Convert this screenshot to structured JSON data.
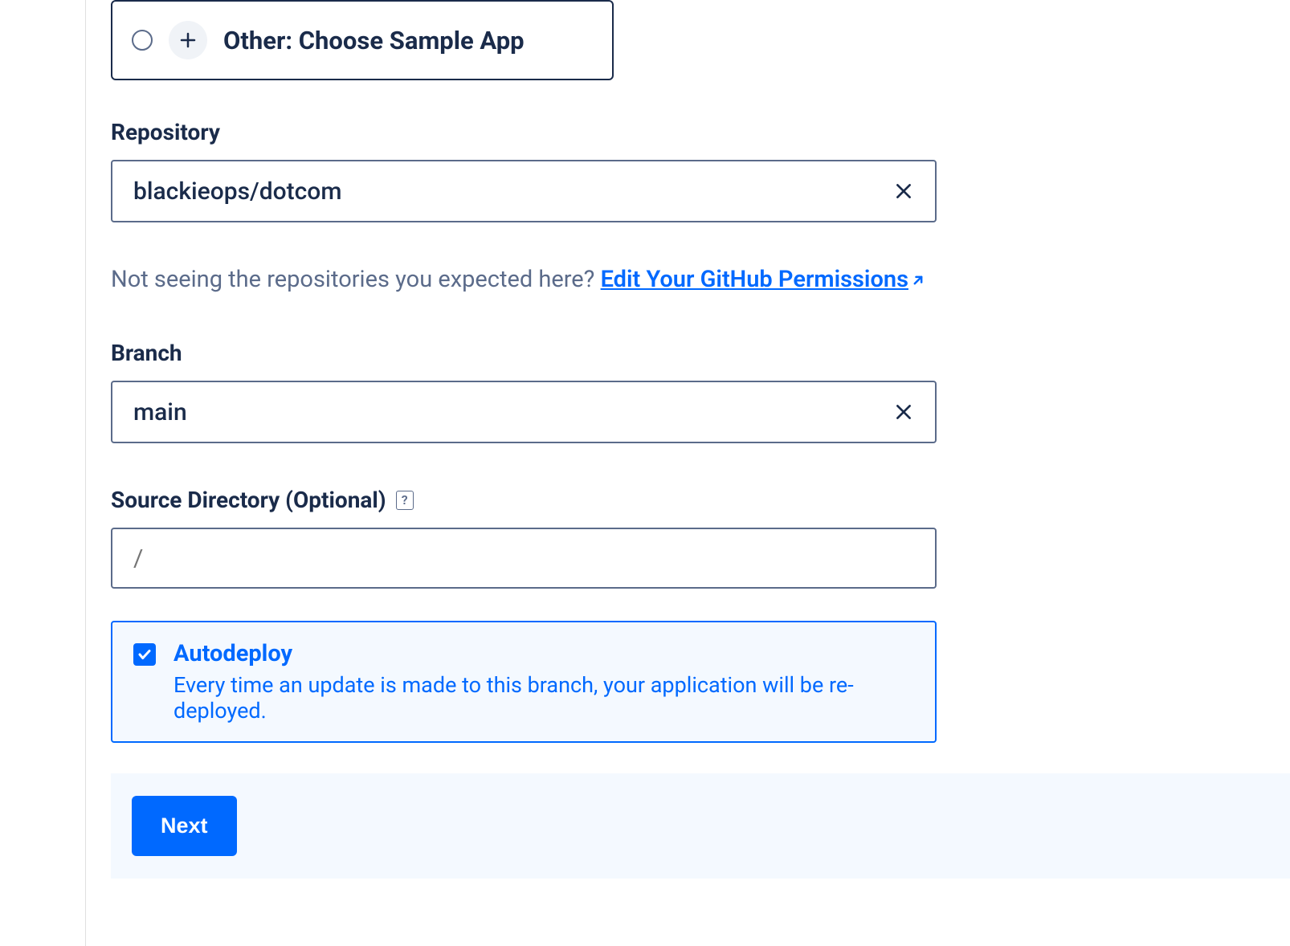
{
  "option": {
    "label": "Other: Choose Sample App"
  },
  "repository": {
    "label": "Repository",
    "value": "blackieops/dotcom"
  },
  "permissions": {
    "help_text": "Not seeing the repositories you expected here? ",
    "link_text": "Edit Your GitHub Permissions"
  },
  "branch": {
    "label": "Branch",
    "value": "main"
  },
  "source_dir": {
    "label": "Source Directory (Optional)",
    "placeholder": "/"
  },
  "autodeploy": {
    "title": "Autodeploy",
    "description": "Every time an update is made to this branch, your application will be re-deployed.",
    "checked": true
  },
  "footer": {
    "next_label": "Next"
  }
}
